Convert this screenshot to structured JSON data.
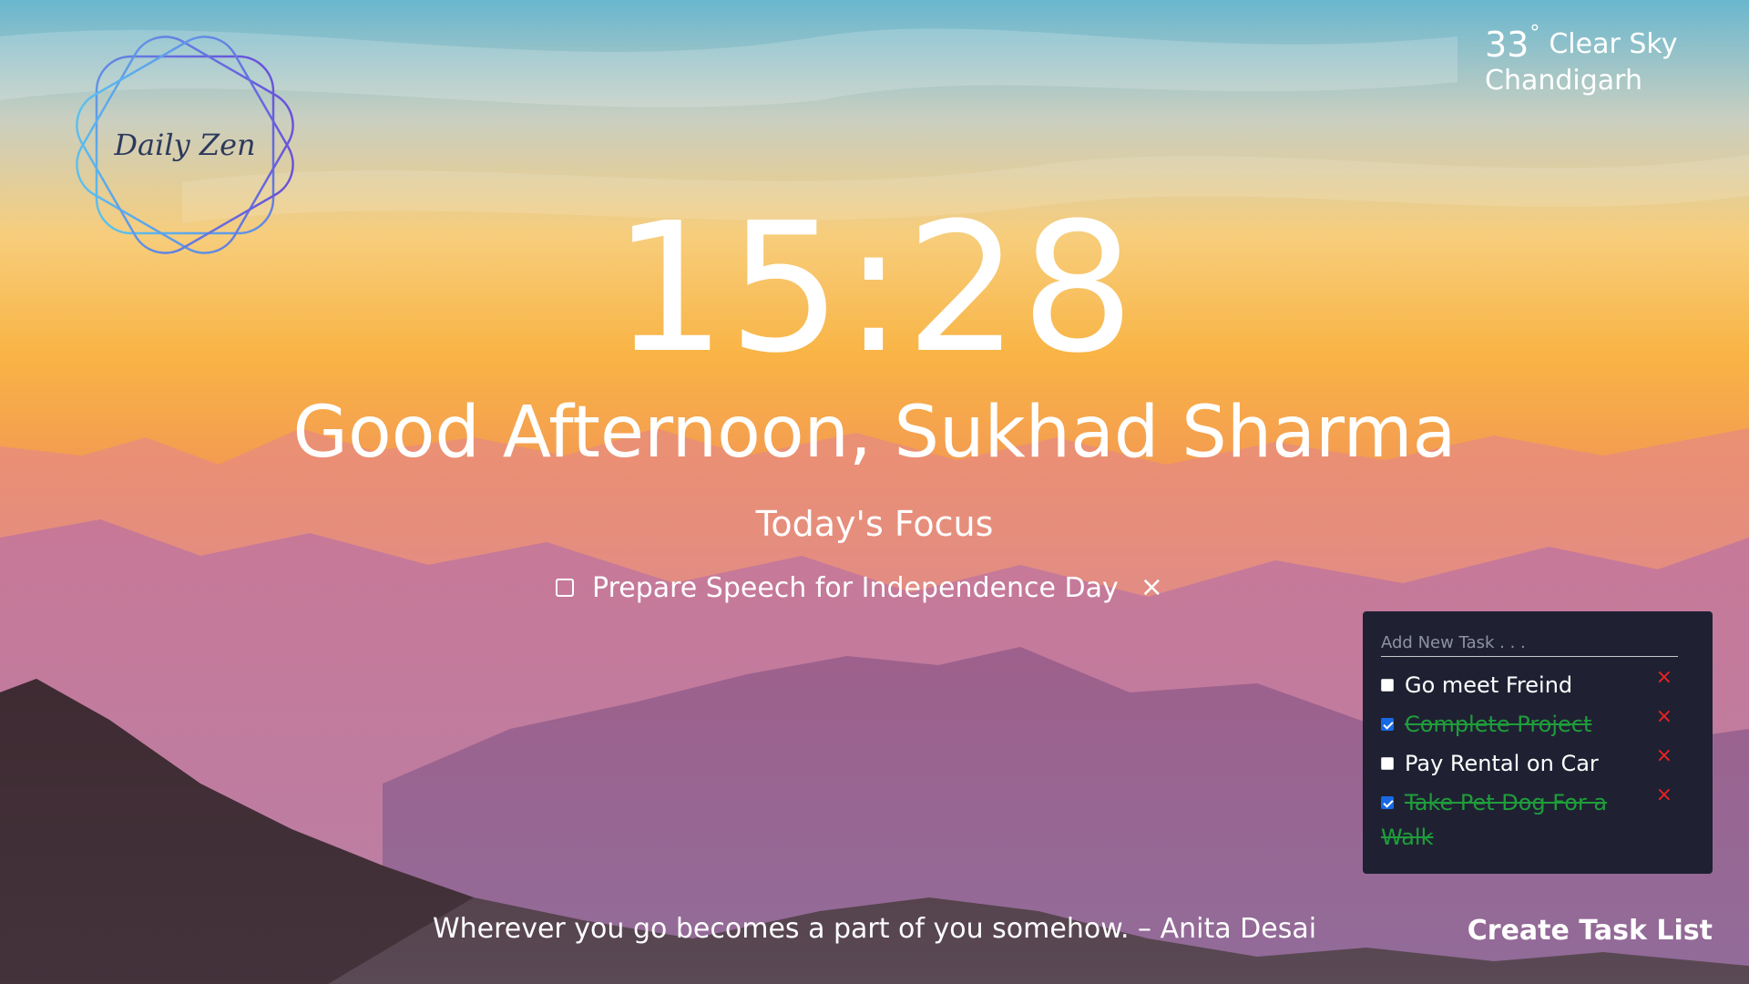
{
  "logo": {
    "text": "Daily Zen"
  },
  "weather": {
    "temperature": "33",
    "degree_symbol": "°",
    "condition": "Clear Sky",
    "city": "Chandigarh"
  },
  "clock": {
    "time": "15:28"
  },
  "greeting": {
    "text": "Good Afternoon, Sukhad Sharma"
  },
  "focus": {
    "title": "Today's Focus",
    "task": "Prepare Speech for Independence Day",
    "checked": false,
    "close_icon": "×"
  },
  "task_panel": {
    "input_placeholder": "Add New Task . . .",
    "input_value": "",
    "delete_icon": "×",
    "tasks": [
      {
        "label": "Go meet Freind",
        "done": false
      },
      {
        "label": "Complete Project",
        "done": true
      },
      {
        "label": "Pay Rental on Car",
        "done": false
      },
      {
        "label": "Take Pet Dog For a Walk",
        "done": true
      }
    ]
  },
  "quote": {
    "text": "Wherever you go becomes a part of you somehow. – Anita Desai"
  },
  "create_button": {
    "label": "Create Task List"
  },
  "colors": {
    "panel_bg": "#1f2133",
    "done_text": "#1f9d3a",
    "delete": "#ee2222",
    "checkbox_checked": "#1769e5"
  }
}
